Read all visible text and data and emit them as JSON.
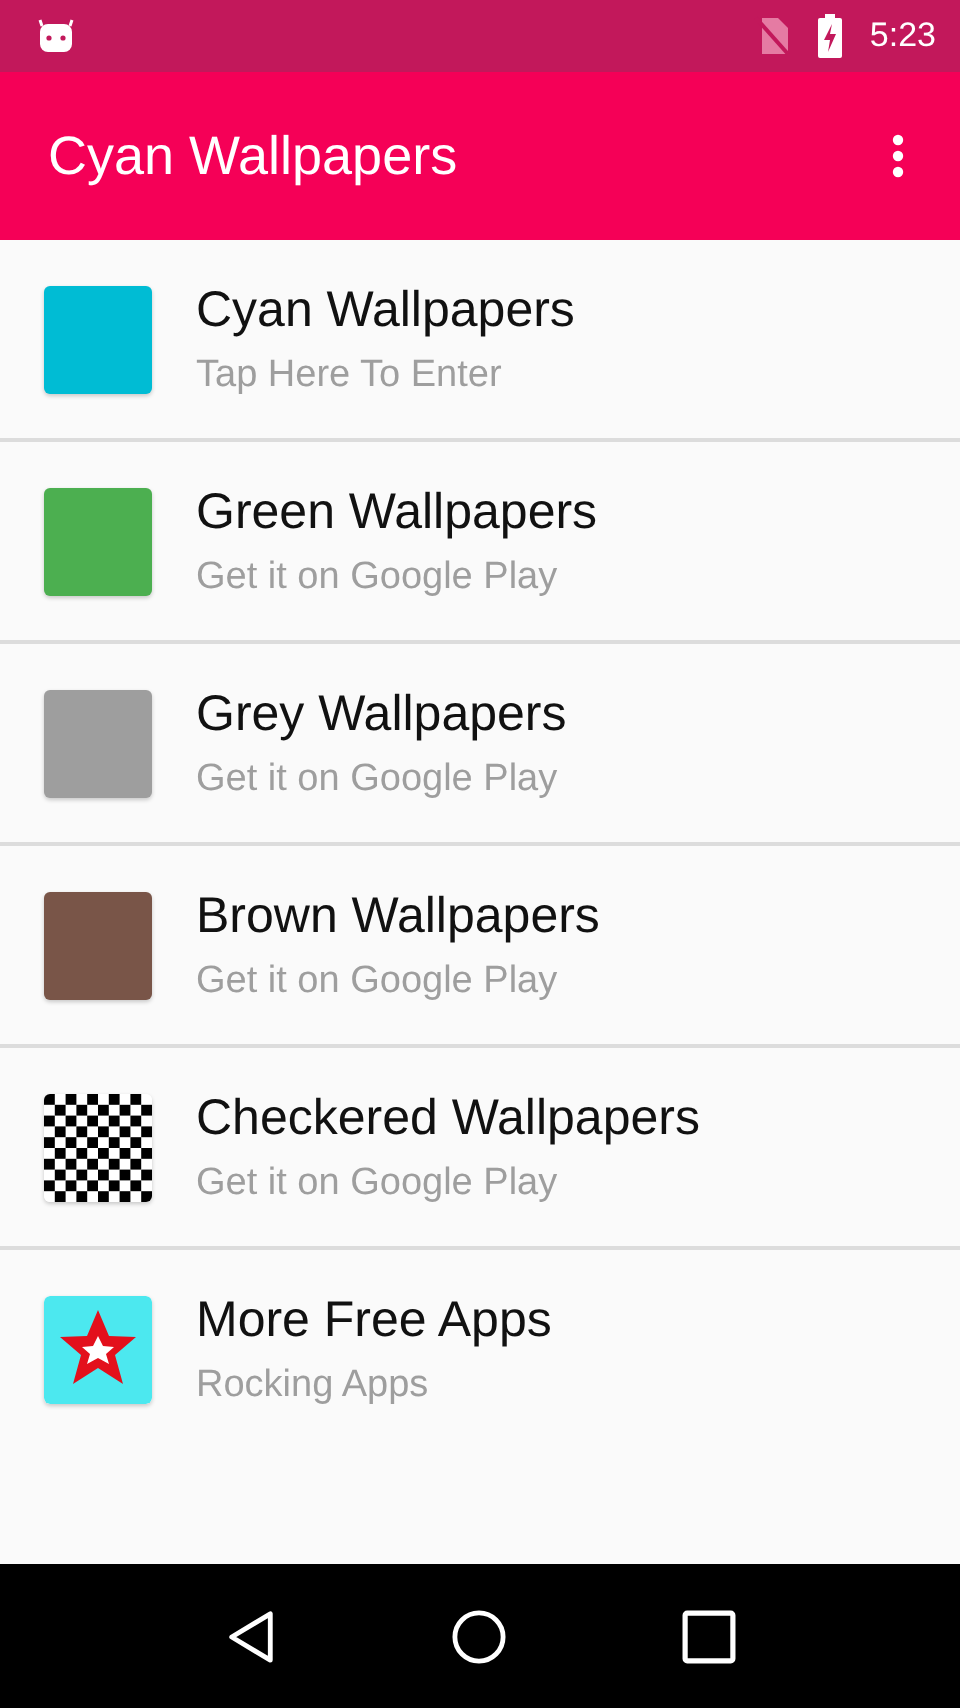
{
  "status_bar": {
    "time": "5:23"
  },
  "app_bar": {
    "title": "Cyan Wallpapers"
  },
  "items": [
    {
      "kind": "swatch",
      "color": "#00bcd4",
      "title": "Cyan Wallpapers",
      "subtitle": "Tap Here To Enter"
    },
    {
      "kind": "swatch",
      "color": "#4caf50",
      "title": "Green Wallpapers",
      "subtitle": "Get it on Google Play"
    },
    {
      "kind": "swatch",
      "color": "#9e9e9e",
      "title": "Grey Wallpapers",
      "subtitle": "Get it on Google Play"
    },
    {
      "kind": "swatch",
      "color": "#795548",
      "title": "Brown Wallpapers",
      "subtitle": "Get it on Google Play"
    },
    {
      "kind": "checker",
      "title": "Checkered Wallpapers",
      "subtitle": "Get it on Google Play"
    },
    {
      "kind": "star",
      "title": "More Free Apps",
      "subtitle": "Rocking Apps"
    }
  ]
}
